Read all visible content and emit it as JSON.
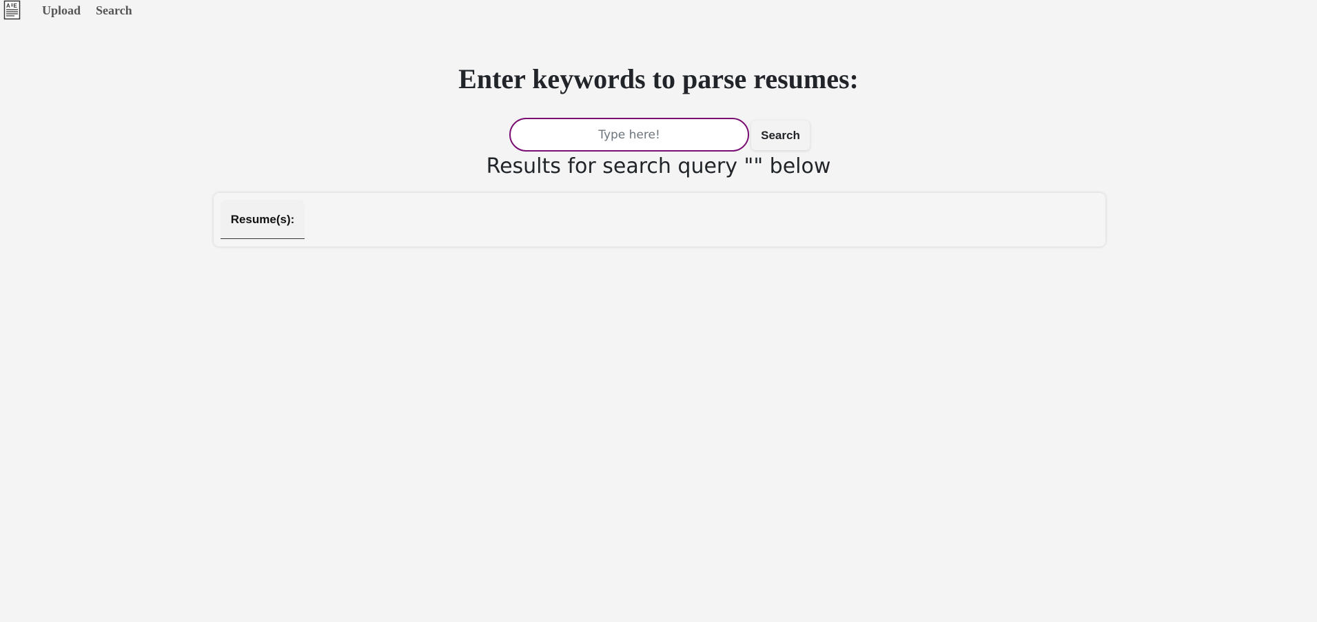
{
  "nav": {
    "logo_icon": "resume-document-icon",
    "links": [
      {
        "label": "Upload"
      },
      {
        "label": "Search"
      }
    ]
  },
  "main": {
    "title": "Enter keywords to parse resumes:",
    "search": {
      "value": "",
      "placeholder": "Type here!",
      "button_label": "Search",
      "border_color": "#7a0d73"
    },
    "results_heading": "Results for search query \"\" below",
    "results": {
      "tabs": [
        {
          "label": "Resume(s):",
          "active": true
        }
      ]
    }
  }
}
